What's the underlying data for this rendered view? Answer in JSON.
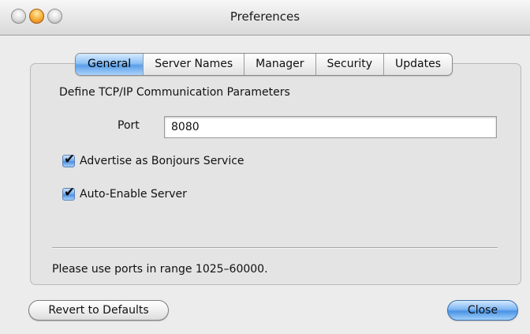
{
  "window": {
    "title": "Preferences",
    "controls": [
      "close-button",
      "minimize-button",
      "zoom-button"
    ]
  },
  "tabs": [
    {
      "label": "General",
      "active": true
    },
    {
      "label": "Server Names",
      "active": false
    },
    {
      "label": "Manager",
      "active": false
    },
    {
      "label": "Security",
      "active": false
    },
    {
      "label": "Updates",
      "active": false
    }
  ],
  "general": {
    "heading": "Define TCP/IP Communication Parameters",
    "port_label": "Port",
    "port_value": "8080",
    "checkboxes": [
      {
        "label": "Advertise as Bonjours Service",
        "checked": true
      },
      {
        "label": "Auto-Enable Server",
        "checked": true
      }
    ],
    "note": "Please use ports in range 1025–60000."
  },
  "buttons": {
    "revert": "Revert to Defaults",
    "close": "Close"
  },
  "colors": {
    "accent": "#5c9fe8",
    "window_bg": "#ececec"
  }
}
